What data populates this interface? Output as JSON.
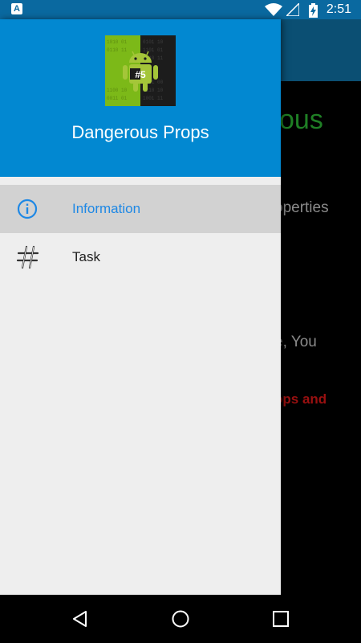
{
  "status_bar": {
    "time": "2:51",
    "left_badge": "A",
    "icons": [
      "wifi-icon",
      "cell-signal-icon",
      "battery-charging-icon"
    ]
  },
  "background_screen": {
    "title_fragment": "ous",
    "line1_fragment": "operties",
    "line2_fragment": "e, You",
    "line3_fragment": "ops and"
  },
  "drawer": {
    "app_name": "Dangerous Props",
    "logo_badge": "#5",
    "items": [
      {
        "label": "Information",
        "icon": "info-icon",
        "active": true
      },
      {
        "label": "Task",
        "icon": "hash-icon",
        "active": false
      }
    ]
  },
  "nav_bar": {
    "buttons": [
      "back-icon",
      "home-icon",
      "recents-icon"
    ]
  },
  "colors": {
    "header": "#0288d1",
    "status_bar": "#0a69a0",
    "active_item_text": "#1e88e5",
    "drawer_bg": "#eeeeee"
  }
}
